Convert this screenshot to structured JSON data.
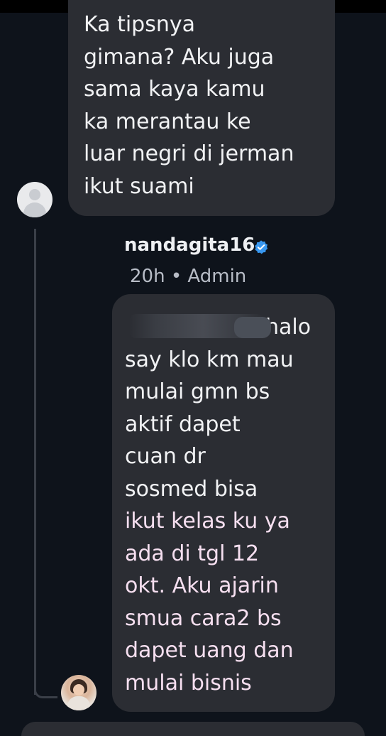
{
  "comment_1": {
    "lines": [
      "Ka tipsnya",
      "gimana? Aku juga",
      "sama kaya kamu",
      "ka merantau ke",
      "luar negri di jerman",
      "ikut suami"
    ]
  },
  "reply": {
    "author": "nandagita16",
    "meta": "20h • Admin",
    "lines": [
      "halo",
      "say klo km mau",
      "mulai gmn bs",
      "aktif dapet",
      "cuan dr",
      "sosmed bisa",
      "ikut kelas ku ya",
      "ada di tgl 12",
      "okt. Aku ajarin",
      "smua cara2 bs",
      "dapet uang dan",
      "mulai bisnis"
    ]
  },
  "colors": {
    "background": "#0e131b",
    "bubble": "#2b2d33",
    "verified": "#3897f0"
  },
  "icons": {
    "verified": "verified-badge-icon",
    "placeholder_avatar": "default-avatar-icon"
  }
}
